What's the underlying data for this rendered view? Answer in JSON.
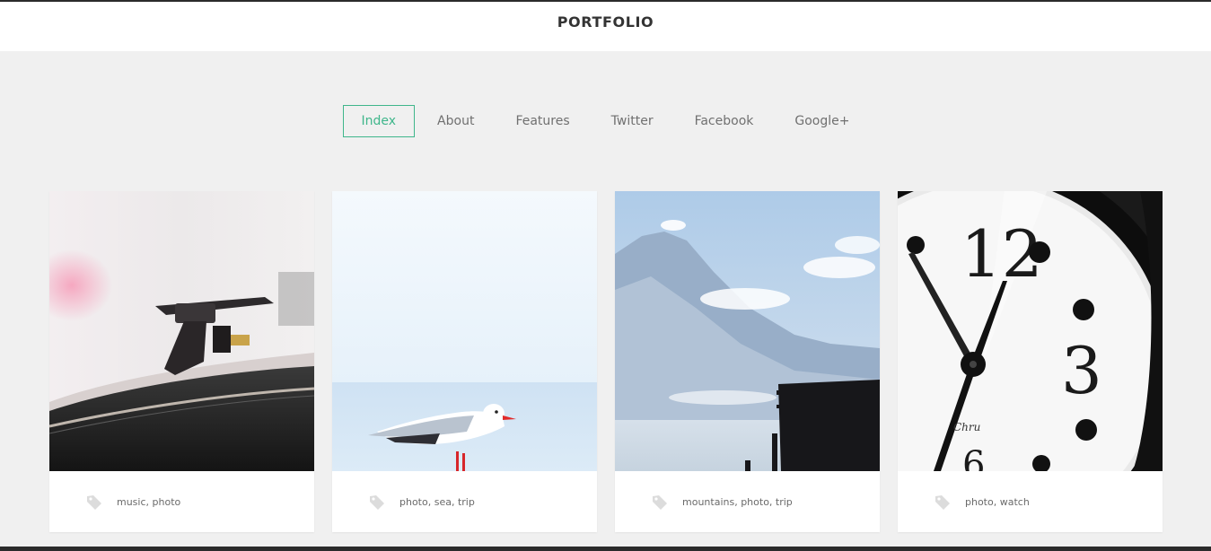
{
  "site": {
    "title": "PORTFOLIO"
  },
  "nav": {
    "items": [
      {
        "label": "Index",
        "active": true
      },
      {
        "label": "About",
        "active": false
      },
      {
        "label": "Features",
        "active": false
      },
      {
        "label": "Twitter",
        "active": false
      },
      {
        "label": "Facebook",
        "active": false
      },
      {
        "label": "Google+",
        "active": false
      }
    ]
  },
  "colors": {
    "accent": "#3fb68b",
    "background": "#f0f0f0",
    "text": "#333333"
  },
  "cards": [
    {
      "image": "turntable-photo",
      "tags": "music, photo"
    },
    {
      "image": "seagull-photo",
      "tags": "photo, sea, trip"
    },
    {
      "image": "mountains-photo",
      "tags": "mountains, photo, trip"
    },
    {
      "image": "clock-photo",
      "tags": "photo, watch"
    }
  ],
  "icons": {
    "tag": "tag-icon"
  }
}
